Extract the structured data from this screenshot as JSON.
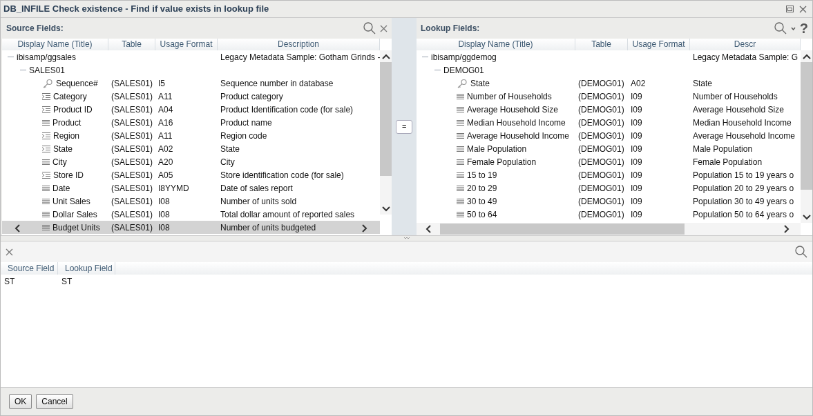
{
  "window": {
    "title": "DB_INFILE Check existence - Find if value exists in lookup file"
  },
  "source": {
    "title": "Source Fields:",
    "columns": [
      "Display Name (Title)",
      "Table",
      "Usage Format",
      "Description"
    ],
    "tree": [
      {
        "name": "ibisamp/ggsales",
        "description": "Legacy Metadata Sample: Gotham Grinds -",
        "expanded": true,
        "children": [
          {
            "name": "SALES01",
            "expanded": true,
            "children": [
              {
                "kind": "key",
                "name": "Sequence#",
                "table": "(SALES01)",
                "format": "I5",
                "description": "Sequence number in database",
                "selected": false
              },
              {
                "kind": "dimension",
                "name": "Category",
                "table": "(SALES01)",
                "format": "A11",
                "description": "Product category",
                "selected": false
              },
              {
                "kind": "dimension",
                "name": "Product ID",
                "table": "(SALES01)",
                "format": "A04",
                "description": "Product Identification code (for sale)",
                "selected": false
              },
              {
                "kind": "measure",
                "name": "Product",
                "table": "(SALES01)",
                "format": "A16",
                "description": "Product name",
                "selected": false
              },
              {
                "kind": "dimension",
                "name": "Region",
                "table": "(SALES01)",
                "format": "A11",
                "description": "Region code",
                "selected": false
              },
              {
                "kind": "dimension",
                "name": "State",
                "table": "(SALES01)",
                "format": "A02",
                "description": "State",
                "selected": false
              },
              {
                "kind": "measure",
                "name": "City",
                "table": "(SALES01)",
                "format": "A20",
                "description": "City",
                "selected": false
              },
              {
                "kind": "dimension",
                "name": "Store ID",
                "table": "(SALES01)",
                "format": "A05",
                "description": "Store identification code (for sale)",
                "selected": false
              },
              {
                "kind": "measure",
                "name": "Date",
                "table": "(SALES01)",
                "format": "I8YYMD",
                "description": "Date of sales report",
                "selected": false
              },
              {
                "kind": "measure",
                "name": "Unit Sales",
                "table": "(SALES01)",
                "format": "I08",
                "description": "Number of units sold",
                "selected": false
              },
              {
                "kind": "measure",
                "name": "Dollar Sales",
                "table": "(SALES01)",
                "format": "I08",
                "description": "Total dollar amount of reported sales",
                "selected": false
              },
              {
                "kind": "measure",
                "name": "Budget Units",
                "table": "(SALES01)",
                "format": "I08",
                "description": "Number of units budgeted",
                "selected": true
              }
            ]
          }
        ]
      }
    ]
  },
  "equals_button": "=",
  "lookup": {
    "title": "Lookup Fields:",
    "help": "?",
    "columns": [
      "Display Name (Title)",
      "Table",
      "Usage Format",
      "Descr"
    ],
    "tree": [
      {
        "name": "ibisamp/ggdemog",
        "description": "Legacy Metadata Sample: G",
        "expanded": true,
        "children": [
          {
            "name": "DEMOG01",
            "expanded": true,
            "children": [
              {
                "kind": "key",
                "name": "State",
                "table": "(DEMOG01)",
                "format": "A02",
                "description": "State",
                "selected": false
              },
              {
                "kind": "measure",
                "name": "Number of Households",
                "table": "(DEMOG01)",
                "format": "I09",
                "description": "Number of Households",
                "selected": false
              },
              {
                "kind": "measure",
                "name": "Average Household Size",
                "table": "(DEMOG01)",
                "format": "I09",
                "description": "Average Household Size",
                "selected": false
              },
              {
                "kind": "measure",
                "name": "Median Household Income",
                "table": "(DEMOG01)",
                "format": "I09",
                "description": "Median Household Income",
                "selected": false
              },
              {
                "kind": "measure",
                "name": "Average Household Income",
                "table": "(DEMOG01)",
                "format": "I09",
                "description": "Average Household Income",
                "selected": false
              },
              {
                "kind": "measure",
                "name": "Male Population",
                "table": "(DEMOG01)",
                "format": "I09",
                "description": "Male Population",
                "selected": false
              },
              {
                "kind": "measure",
                "name": "Female Population",
                "table": "(DEMOG01)",
                "format": "I09",
                "description": "Female Population",
                "selected": false
              },
              {
                "kind": "measure",
                "name": "15 to 19",
                "table": "(DEMOG01)",
                "format": "I09",
                "description": "Population 15 to 19 years o",
                "selected": false
              },
              {
                "kind": "measure",
                "name": "20 to 29",
                "table": "(DEMOG01)",
                "format": "I09",
                "description": "Population 20 to 29 years o",
                "selected": false
              },
              {
                "kind": "measure",
                "name": "30 to 49",
                "table": "(DEMOG01)",
                "format": "I09",
                "description": "Population 30 to 49 years o",
                "selected": false
              },
              {
                "kind": "measure",
                "name": "50 to 64",
                "table": "(DEMOG01)",
                "format": "I09",
                "description": "Population 50 to 64 years o",
                "selected": false
              }
            ]
          }
        ]
      }
    ]
  },
  "mapping": {
    "columns": [
      "Source Field",
      "Lookup Field"
    ],
    "rows": [
      [
        "ST",
        "ST"
      ]
    ]
  },
  "buttons": [
    "OK",
    "Cancel"
  ]
}
